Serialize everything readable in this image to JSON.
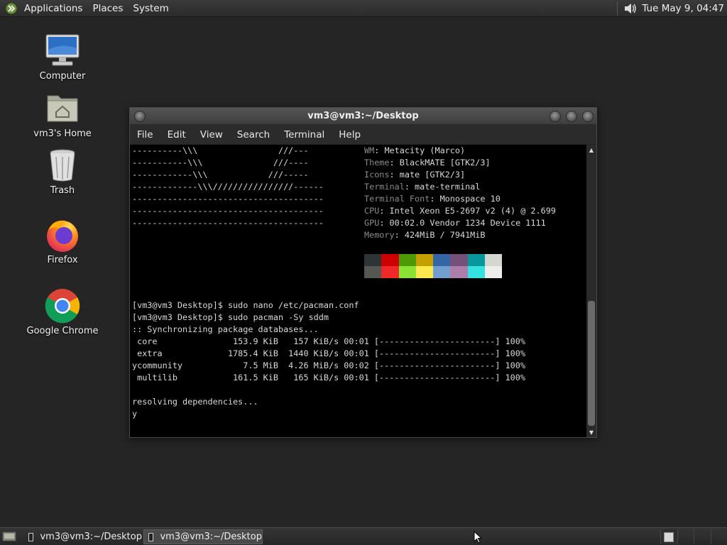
{
  "top_panel": {
    "menus": [
      "Applications",
      "Places",
      "System"
    ],
    "clock": "Tue May  9, 04:47"
  },
  "desktop_icons": [
    {
      "label": "Computer",
      "icon": "computer-icon"
    },
    {
      "label": "vm3's Home",
      "icon": "home-folder-icon"
    },
    {
      "label": "Trash",
      "icon": "trash-icon"
    },
    {
      "label": "Firefox",
      "icon": "firefox-icon"
    },
    {
      "label": "Google Chrome",
      "icon": "chrome-icon"
    }
  ],
  "terminal": {
    "title": "vm3@vm3:~/Desktop",
    "menu": [
      "File",
      "Edit",
      "View",
      "Search",
      "Terminal",
      "Help"
    ],
    "art_lines": [
      "----------\\\\\\                ///---",
      "-----------\\\\\\              ///----",
      "------------\\\\\\            ///-----",
      "-------------\\\\\\////////////////------",
      "--------------------------------------",
      "--------------------------------------",
      "--------------------------------------"
    ],
    "info": [
      {
        "key": "WM",
        "value": "Metacity (Marco)"
      },
      {
        "key": "Theme",
        "value": "BlackMATE [GTK2/3]"
      },
      {
        "key": "Icons",
        "value": "mate [GTK2/3]"
      },
      {
        "key": "Terminal",
        "value": "mate-terminal"
      },
      {
        "key": "Terminal Font",
        "value": "Monospace 10"
      },
      {
        "key": "CPU",
        "value": "Intel Xeon E5-2697 v2 (4) @ 2.699"
      },
      {
        "key": "GPU",
        "value": "00:02.0 Vendor 1234 Device 1111"
      },
      {
        "key": "Memory",
        "value": "424MiB / 7941MiB"
      }
    ],
    "palette_top": [
      "#2e3436",
      "#cc0000",
      "#4e9a06",
      "#c4a000",
      "#3465a4",
      "#75507b",
      "#06989a",
      "#d3d7cf"
    ],
    "palette_bottom": [
      "#555753",
      "#ef2929",
      "#8ae234",
      "#fce94f",
      "#729fcf",
      "#ad7fa8",
      "#34e2e2",
      "#eeeeec"
    ],
    "output": [
      "[vm3@vm3 Desktop]$ sudo nano /etc/pacman.conf",
      "[vm3@vm3 Desktop]$ sudo pacman -Sy sddm",
      ":: Synchronizing package databases...",
      " core               153.9 KiB   157 KiB/s 00:01 [-----------------------] 100%",
      " extra             1785.4 KiB  1440 KiB/s 00:01 [-----------------------] 100%",
      "ycommunity            7.5 MiB  4.26 MiB/s 00:02 [-----------------------] 100%",
      " multilib           161.5 KiB   165 KiB/s 00:01 [-----------------------] 100%",
      "",
      "resolving dependencies...",
      "y"
    ]
  },
  "taskbar": {
    "tasks": [
      {
        "label": "vm3@vm3:~/Desktop",
        "active": false
      },
      {
        "label": "vm3@vm3:~/Desktop",
        "active": true
      }
    ]
  }
}
